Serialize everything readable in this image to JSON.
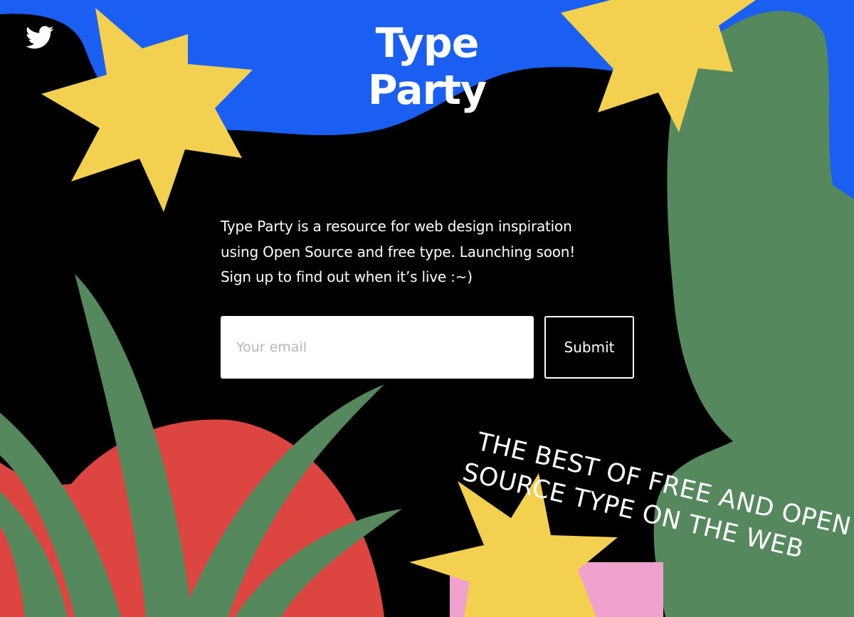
{
  "social": {
    "twitter_icon": "twitter-bird-icon"
  },
  "header": {
    "title_line1": "Type",
    "title_line2": "Party"
  },
  "intro": {
    "line1": "Type Party is a resource for web design inspiration",
    "line2": "using Open Source and free type. Launching soon!",
    "line3": "Sign up to find out when it’s live :~)"
  },
  "signup": {
    "email_placeholder": "Your email",
    "email_value": "",
    "submit_label": "Submit"
  },
  "tagline": {
    "line1": "THE BEST OF FREE AND OPEN",
    "line2": "SOURCE TYPE ON THE WEB"
  },
  "colors": {
    "background": "#000000",
    "blue": "#1a5ef2",
    "yellow": "#f4d050",
    "green": "#55895d",
    "red": "#dd4640",
    "pink": "#f0a1cc",
    "white": "#ffffff"
  }
}
